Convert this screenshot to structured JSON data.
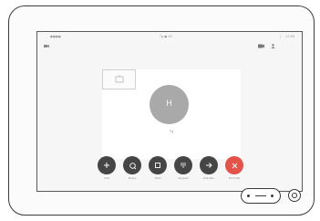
{
  "status_bar": {
    "left_label": "●●●●",
    "center_label": "Tg  ● 00",
    "time": "11:58",
    "left_icon": "video-icon",
    "right_icons": [
      "camera-icon",
      "person-icon"
    ]
  },
  "call": {
    "avatar_initial": "H",
    "caller_name": "Tg"
  },
  "buttons": [
    {
      "label": "Add",
      "icon": "plus-icon"
    },
    {
      "label": "Share",
      "icon": "share-icon"
    },
    {
      "label": "Hold",
      "icon": "pause-icon"
    },
    {
      "label": "Keypad",
      "icon": "keypad-icon"
    },
    {
      "label": "Transfer",
      "icon": "transfer-icon"
    },
    {
      "label": "End Call",
      "icon": "close-icon"
    }
  ],
  "colors": {
    "button_dark": "#454545",
    "end_call": "#e25449",
    "avatar": "#a9a9a9"
  }
}
